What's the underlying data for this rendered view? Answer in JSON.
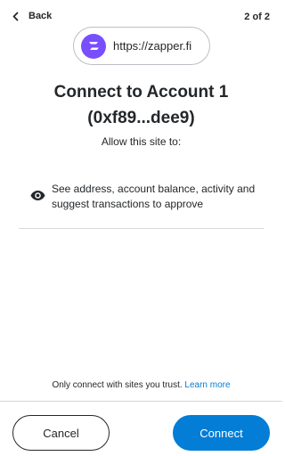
{
  "header": {
    "back_label": "Back",
    "step": "2 of 2",
    "back_icon": "chevron-left-icon"
  },
  "site": {
    "url": "https://zapper.fi",
    "logo_icon": "zapper-logo",
    "logo_color": "#784ffe"
  },
  "title": {
    "line1": "Connect to Account 1",
    "line2": "(0xf89...dee9)"
  },
  "subtitle": "Allow this site to:",
  "permissions": [
    {
      "icon": "eye-icon",
      "text": "See address, account balance, activity and suggest transactions to approve"
    }
  ],
  "footer": {
    "note": "Only connect with sites you trust.",
    "learn_more": "Learn more"
  },
  "buttons": {
    "cancel": "Cancel",
    "connect": "Connect"
  },
  "colors": {
    "primary": "#037dd6",
    "text": "#24272a",
    "divider": "#d6d9dc"
  }
}
